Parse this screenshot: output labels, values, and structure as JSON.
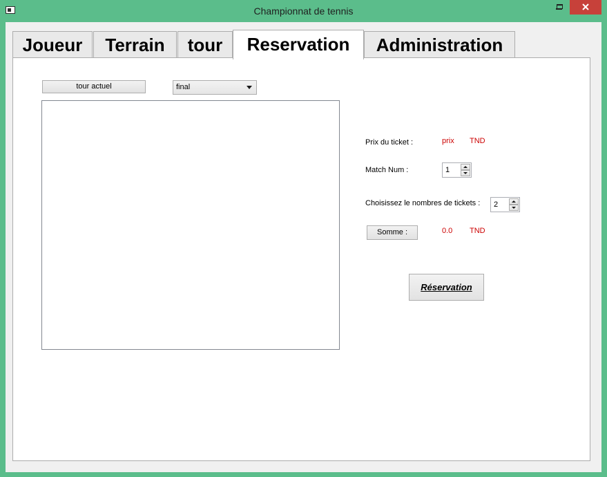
{
  "window": {
    "title": "Championnat de tennis",
    "controls": {
      "minimize": "minimize-icon",
      "maximize": "maximize-icon",
      "close": "close-icon"
    },
    "accent_color": "#5bbd8b",
    "close_color": "#c7413a"
  },
  "tabs": [
    {
      "label": "Joueur"
    },
    {
      "label": "Terrain"
    },
    {
      "label": "tour"
    },
    {
      "label": "Reservation",
      "active": true
    },
    {
      "label": "Administration"
    }
  ],
  "reservation": {
    "tour_button_label": "tour actuel",
    "tour_select": {
      "selected": "final"
    },
    "prix_label": "Prix du ticket :",
    "prix_value": "prix",
    "prix_currency": "TND",
    "match_label": "Match Num :",
    "match_value": "1",
    "tickets_label": "Choisissez le nombres de tickets :",
    "tickets_value": "2",
    "somme_button_label": "Somme :",
    "somme_value": "0.0",
    "somme_currency": "TND",
    "reserve_button_label": "Réservation",
    "value_color": "#cc0000"
  }
}
